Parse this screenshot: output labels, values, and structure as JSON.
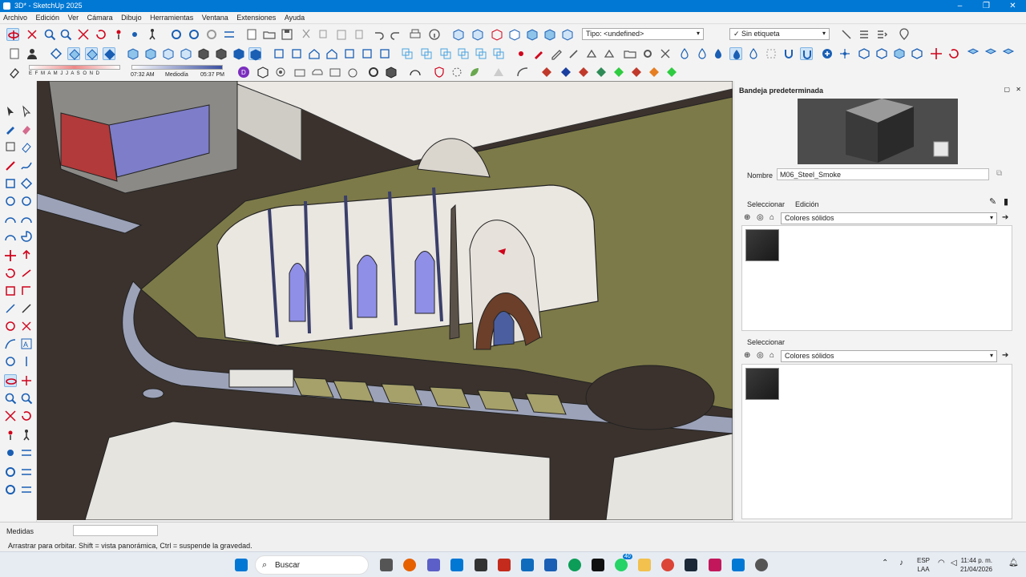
{
  "window": {
    "title": "3D* - SketchUp 2025",
    "controls": [
      "–",
      "❐",
      "✕"
    ]
  },
  "menu": [
    "Archivo",
    "Edición",
    "Ver",
    "Cámara",
    "Dibujo",
    "Herramientas",
    "Ventana",
    "Extensiones",
    "Ayuda"
  ],
  "toolbar": {
    "tag_type_label": "Tipo: <undefined>",
    "tag_label": "Sin etiqueta",
    "shadow_months": "E F M A M J J A S O N D",
    "shadow_time_start": "07:32 AM",
    "shadow_time_mid": "Mediodía",
    "shadow_time_end": "05:37 PM"
  },
  "tray": {
    "title": "Bandeja predeterminada",
    "name_label": "Nombre",
    "name_value": "M06_Steel_Smoke",
    "tab_select": "Seleccionar",
    "tab_edit": "Edición",
    "collection_1": "Colores sólidos",
    "section2_label": "Seleccionar",
    "collection_2": "Colores sólidos"
  },
  "status": {
    "measure_label": "Medidas",
    "hint": "Arrastrar para orbitar. Shift = vista panorámica, Ctrl = suspende la gravedad."
  },
  "taskbar": {
    "search_placeholder": "Buscar",
    "lang_1": "ESP",
    "lang_2": "LAA",
    "time": "11:44 p. m.",
    "date": "21/04/2026",
    "badge_count": "40"
  },
  "colors": {
    "accent": "#0078d4",
    "grass": "#7d7a49",
    "asphalt": "#3b322d",
    "glass": "#8f8fe8"
  }
}
